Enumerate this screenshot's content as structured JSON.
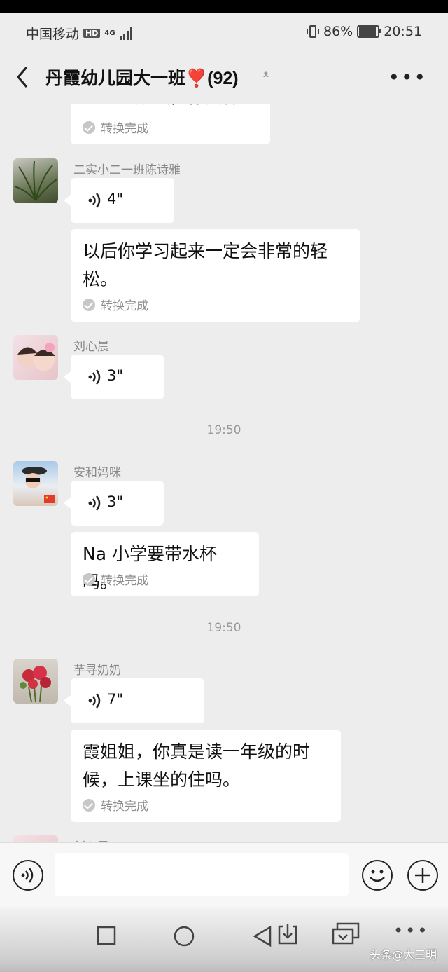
{
  "status_bar": {
    "carrier": "中国移动",
    "hd_label": "HD",
    "network": "4G",
    "battery": "86%",
    "time": "20:51"
  },
  "header": {
    "title": "丹霞幼儿园大一班❣️(92)",
    "back_icon": "chevron-left-icon",
    "earpiece_icon": "ear-icon",
    "more_icon": "more-icon"
  },
  "messages": [
    {
      "type": "text",
      "partial": true,
      "text": "这个小朋友，你真棒。",
      "status": "转换完成"
    },
    {
      "sender": "二实小二一班陈诗雅",
      "type": "voice",
      "duration": "4\""
    },
    {
      "type": "text",
      "text_lines": [
        "以后你学习起来一定会非常的轻",
        "松。"
      ],
      "status": "转换完成"
    },
    {
      "sender": "刘心晨",
      "type": "voice",
      "duration": "3\""
    },
    {
      "type": "time",
      "text": "19:50"
    },
    {
      "sender": "安和妈咪",
      "type": "voice",
      "duration": "3\""
    },
    {
      "type": "text",
      "text_lines": [
        "Na 小学要带水杯吗。"
      ],
      "status": "转换完成"
    },
    {
      "type": "time",
      "text": "19:50"
    },
    {
      "sender": "芋寻奶奶",
      "type": "voice",
      "duration": "7\""
    },
    {
      "type": "text",
      "text_lines": [
        "霞姐姐，你真是读一年级的时",
        "候，上课坐的住吗。"
      ],
      "status": "转换完成"
    },
    {
      "sender": "刘心晨",
      "partial": true
    }
  ],
  "input_bar": {
    "voice_icon": "voice-input-icon",
    "emoji_icon": "emoji-icon",
    "plus_icon": "plus-icon",
    "text_value": ""
  },
  "nav_bar": {
    "icons": [
      "square-icon",
      "circle-icon",
      "back-triangle-icon",
      "download-icon",
      "screen-icon",
      "more-dots-icon"
    ],
    "watermark": "头条@大三明"
  }
}
